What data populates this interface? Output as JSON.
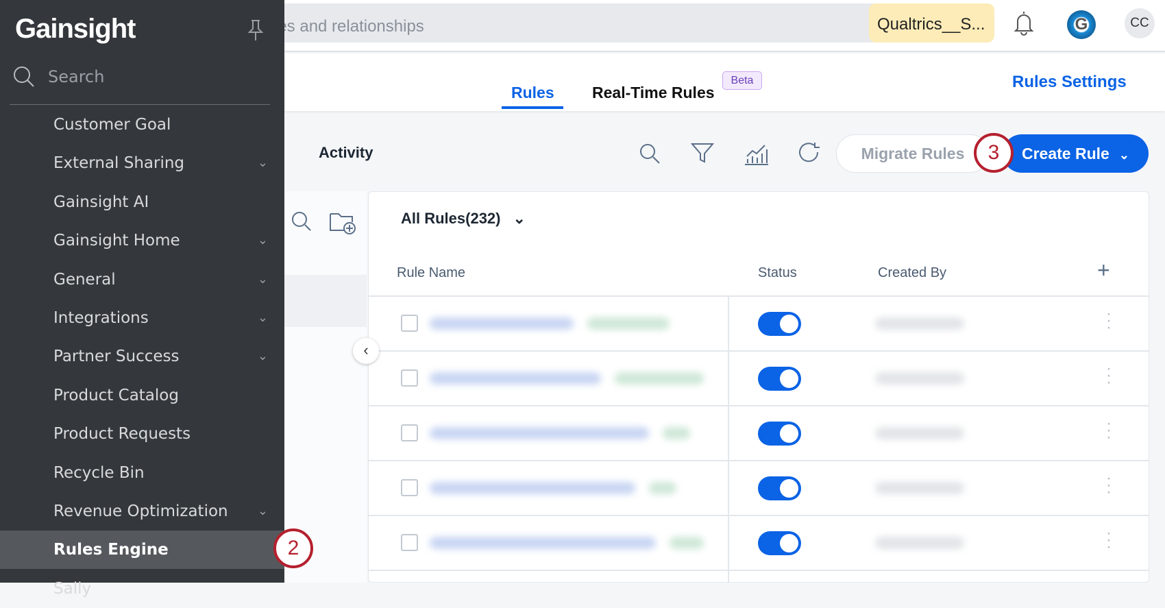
{
  "topbar": {
    "search_placeholder": "ies and relationships",
    "org": "Qualtrics__S...",
    "avatar": "CC"
  },
  "tabs": [
    {
      "label": "Rules",
      "active": true
    },
    {
      "label": "Real-Time Rules",
      "badge": "Beta"
    }
  ],
  "rules_settings": "Rules Settings",
  "toolbar": {
    "activity": "Activity",
    "migrate": "Migrate Rules",
    "create": "Create Rule"
  },
  "sidebar": {
    "logo": "Gainsight",
    "search": "Search",
    "items": [
      {
        "label": "Customer Goal",
        "expandable": false
      },
      {
        "label": "External Sharing",
        "expandable": true
      },
      {
        "label": "Gainsight AI",
        "expandable": false
      },
      {
        "label": "Gainsight Home",
        "expandable": true
      },
      {
        "label": "General",
        "expandable": true
      },
      {
        "label": "Integrations",
        "expandable": true
      },
      {
        "label": "Partner Success",
        "expandable": true
      },
      {
        "label": "Product Catalog",
        "expandable": false
      },
      {
        "label": "Product Requests",
        "expandable": false
      },
      {
        "label": "Recycle Bin",
        "expandable": false
      },
      {
        "label": "Revenue Optimization",
        "expandable": true
      },
      {
        "label": "Rules Engine",
        "expandable": false,
        "active": true
      },
      {
        "label": "Sally",
        "expandable": false
      }
    ]
  },
  "table": {
    "title": "All Rules(232)",
    "columns": [
      "Rule Name",
      "Status",
      "Created By"
    ],
    "rows": [
      {
        "status": true
      },
      {
        "status": true
      },
      {
        "status": true
      },
      {
        "status": true
      },
      {
        "status": true
      }
    ]
  },
  "callouts": {
    "step2": "2",
    "step3": "3"
  },
  "colors": {
    "accent": "#0b63e5",
    "sidebar": "#34383c",
    "callout": "#b5202e"
  }
}
